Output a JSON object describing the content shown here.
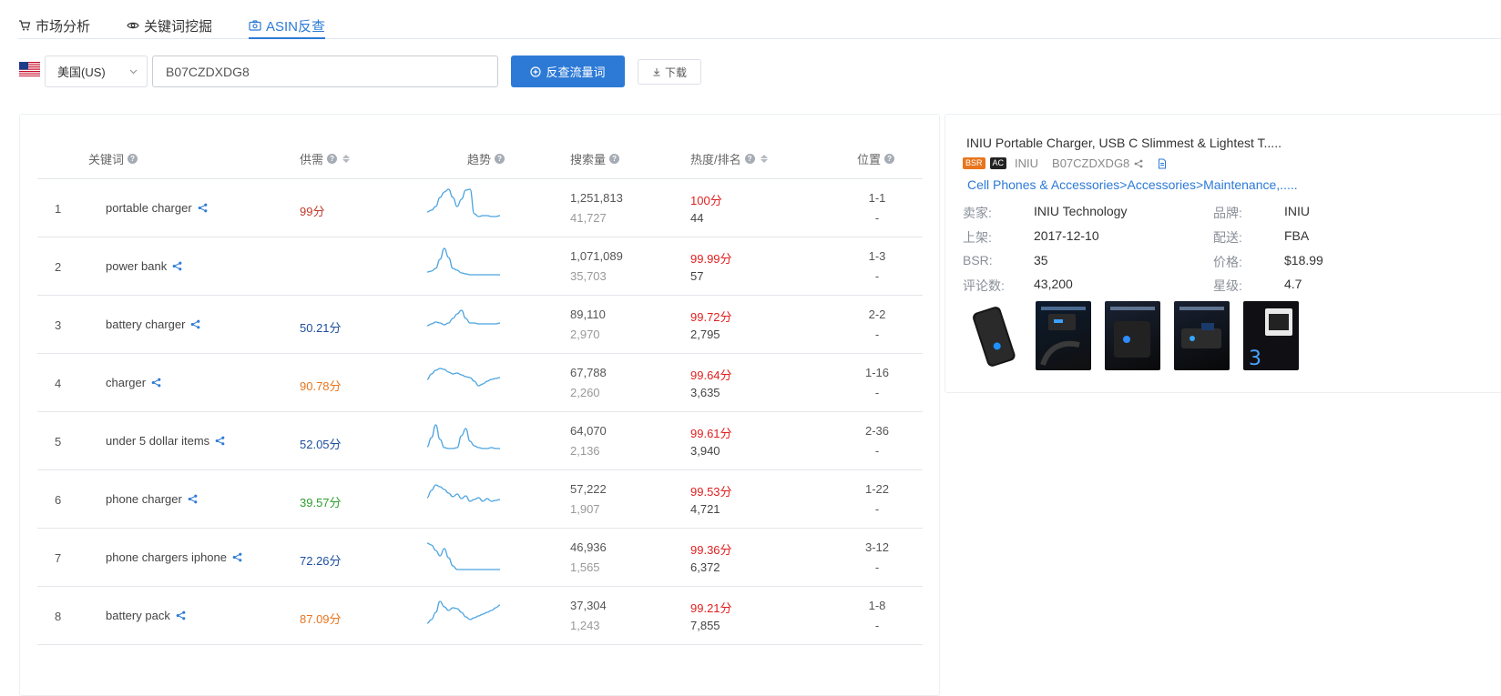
{
  "tabs": [
    {
      "label": "市场分析",
      "icon": "cart-icon",
      "active": false
    },
    {
      "label": "关键词挖掘",
      "icon": "eye-icon",
      "active": false
    },
    {
      "label": "ASIN反查",
      "icon": "camera-icon",
      "active": true
    }
  ],
  "search": {
    "marketplace": "美国(US)",
    "asin_value": "B07CZDXDG8",
    "submit_label": "反查流量词",
    "download_label": "下载"
  },
  "table": {
    "headers": {
      "keyword": "关键词",
      "supply": "供需",
      "trend": "趋势",
      "search_volume": "搜索量",
      "heat_rank": "热度/排名",
      "position": "位置"
    },
    "rows": [
      {
        "rank": "1",
        "keyword": "portable charger",
        "supply": "99分",
        "supply_color": "#c03a2b",
        "search_volume": "1,251,813",
        "search_sub": "41,727",
        "heat": "100分",
        "heat_rank": "44",
        "position": "1-1",
        "position_sub": "-",
        "trend": [
          28,
          26,
          22,
          12,
          6,
          3,
          12,
          22,
          14,
          4,
          3,
          30,
          33,
          32,
          32,
          33,
          33,
          32
        ]
      },
      {
        "rank": "2",
        "keyword": "power bank",
        "supply": "",
        "supply_color": "#333333",
        "search_volume": "1,071,089",
        "search_sub": "35,703",
        "heat": "99.99分",
        "heat_rank": "57",
        "position": "1-3",
        "position_sub": "-",
        "trend": [
          30,
          29,
          26,
          16,
          4,
          14,
          26,
          28,
          31,
          32,
          33,
          33,
          33,
          33,
          33,
          33,
          33,
          33
        ]
      },
      {
        "rank": "3",
        "keyword": "battery charger",
        "supply": "50.21分",
        "supply_color": "#1d4f9c",
        "search_volume": "89,110",
        "search_sub": "2,970",
        "heat": "99.72分",
        "heat_rank": "2,795",
        "position": "2-2",
        "position_sub": "-",
        "trend": [
          25,
          23,
          21,
          22,
          24,
          22,
          17,
          12,
          8,
          17,
          22,
          22,
          23,
          23,
          23,
          23,
          23,
          22
        ]
      },
      {
        "rank": "4",
        "keyword": "charger",
        "supply": "90.78分",
        "supply_color": "#e8761e",
        "search_volume": "67,788",
        "search_sub": "2,260",
        "heat": "99.64分",
        "heat_rank": "3,635",
        "position": "1-16",
        "position_sub": "-",
        "trend": [
          20,
          14,
          10,
          8,
          9,
          12,
          14,
          13,
          15,
          17,
          18,
          22,
          27,
          25,
          22,
          20,
          19,
          18
        ]
      },
      {
        "rank": "5",
        "keyword": "under 5 dollar items",
        "supply": "52.05分",
        "supply_color": "#1d4f9c",
        "search_volume": "64,070",
        "search_sub": "2,136",
        "heat": "99.61分",
        "heat_rank": "3,940",
        "position": "2-36",
        "position_sub": "-",
        "trend": [
          30,
          20,
          6,
          22,
          31,
          32,
          32,
          31,
          18,
          10,
          24,
          29,
          31,
          32,
          32,
          31,
          32,
          32
        ]
      },
      {
        "rank": "6",
        "keyword": "phone charger",
        "supply": "39.57分",
        "supply_color": "#2e9e2e",
        "search_volume": "57,222",
        "search_sub": "1,907",
        "heat": "99.53分",
        "heat_rank": "4,721",
        "position": "1-22",
        "position_sub": "-",
        "trend": [
          22,
          14,
          8,
          10,
          13,
          17,
          21,
          18,
          23,
          20,
          26,
          24,
          22,
          26,
          23,
          26,
          25,
          24
        ]
      },
      {
        "rank": "7",
        "keyword": "phone chargers iphone",
        "supply": "72.26分",
        "supply_color": "#1d4f9c",
        "search_volume": "46,936",
        "search_sub": "1,565",
        "heat": "99.36分",
        "heat_rank": "6,372",
        "position": "3-12",
        "position_sub": "-",
        "trend": [
          8,
          10,
          16,
          22,
          14,
          24,
          33,
          37,
          37,
          37,
          37,
          37,
          37,
          37,
          37,
          37,
          37,
          37
        ]
      },
      {
        "rank": "8",
        "keyword": "battery pack",
        "supply": "87.09分",
        "supply_color": "#e8761e",
        "search_volume": "37,304",
        "search_sub": "1,243",
        "heat": "99.21分",
        "heat_rank": "7,855",
        "position": "1-8",
        "position_sub": "-",
        "trend": [
          32,
          28,
          20,
          8,
          14,
          18,
          15,
          16,
          20,
          25,
          28,
          26,
          24,
          22,
          20,
          18,
          15,
          12
        ]
      }
    ]
  },
  "product": {
    "title": "INIU Portable Charger, USB C Slimmest & Lightest T.....",
    "badge_bsr": "BSR",
    "badge_ac": "AC",
    "brand_short": "INIU",
    "asin": "B07CZDXDG8",
    "category": "Cell Phones & Accessories>Accessories>Maintenance,.....",
    "fields": {
      "seller_label": "卖家:",
      "seller": "INIU Technology",
      "brand_label": "品牌:",
      "brand": "INIU",
      "listed_label": "上架:",
      "listed": "2017-12-10",
      "shipping_label": "配送:",
      "shipping": "FBA",
      "bsr_label": "BSR:",
      "bsr": "35",
      "price_label": "价格:",
      "price": "$18.99",
      "reviews_label": "评论数:",
      "reviews": "43,200",
      "stars_label": "星级:",
      "stars": "4.7"
    }
  },
  "colors": {
    "accent": "#2d7ad6",
    "heat_red": "#e01e1e",
    "trend_line": "#4aa3df"
  }
}
